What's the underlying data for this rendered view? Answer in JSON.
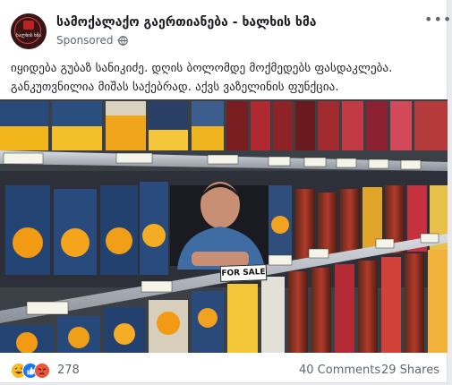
{
  "post": {
    "page_name": "სამოქალაქო გაერთიანება - ხალხის ხმა",
    "sponsored_label": "Sponsored",
    "sponsored_sep": "·",
    "avatar_text": "ხალხის ხმა",
    "more_icon": "more-options-icon",
    "globe_icon": "globe-icon",
    "caption_line1": "იყიდება გუბაზ სანიკიძე. დღის ბოლომდე მოქმედებს ფასდაკლება.",
    "caption_line2": "განკუთვნილია მიშას საქებრად. აქვს ვაზელინის ფუნქცია.",
    "photo": {
      "sign_text": "FOR SALE",
      "price_tags": [
        "€",
        "€",
        "€",
        "€",
        "€"
      ]
    },
    "reactions": {
      "icons": [
        "haha-reaction-icon",
        "like-reaction-icon",
        "angry-reaction-icon"
      ],
      "count": "278"
    },
    "comments_label": "40 Comments",
    "shares_label": "29 Shares"
  },
  "colors": {
    "brand_blue": "#1877f2",
    "text_primary": "#1c1e21",
    "text_secondary": "#606770",
    "haha_yellow": "#f7b928",
    "angry_orange": "#e8553b"
  }
}
